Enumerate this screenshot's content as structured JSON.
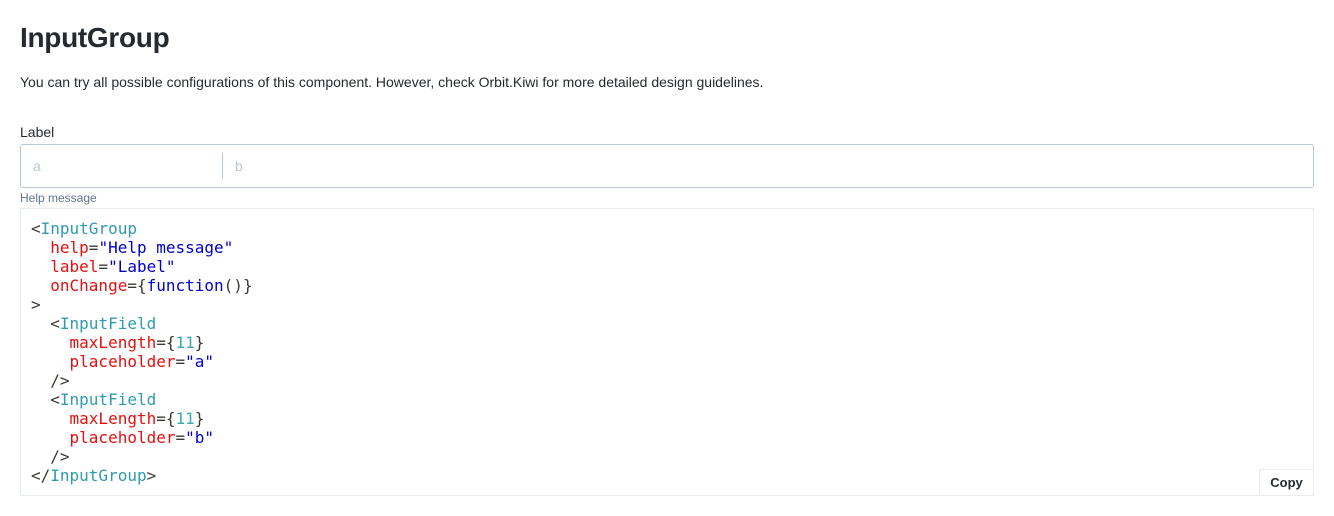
{
  "header": {
    "title": "InputGroup",
    "description": "You can try all possible configurations of this component. However, check Orbit.Kiwi for more detailed design guidelines."
  },
  "input_group": {
    "label": "Label",
    "help": "Help message",
    "fields": [
      {
        "placeholder": "a",
        "value": ""
      },
      {
        "placeholder": "b",
        "value": ""
      }
    ]
  },
  "code": {
    "copy_label": "Copy",
    "tokens": {
      "lt": "<",
      "gt": ">",
      "close_open": "</",
      "self_close": "/>",
      "eq": "=",
      "component_group": "InputGroup",
      "component_field": "InputField",
      "attr_help": "help",
      "attr_label": "label",
      "attr_onchange": "onChange",
      "attr_maxlength": "maxLength",
      "attr_placeholder": "placeholder",
      "val_help": "\"Help message\"",
      "val_label": "\"Label\"",
      "val_function": "function",
      "val_parens": "()",
      "val_maxlength": "11",
      "val_placeholder_a": "\"a\"",
      "val_placeholder_b": "\"b\"",
      "brace_open": "{",
      "brace_close": "}"
    }
  },
  "colors": {
    "border": "#bac7d5",
    "placeholder": "#bac7d5",
    "help_text": "#5f738c",
    "code_tag": "#2f9bb0",
    "code_attr": "#e60f0f",
    "code_string": "#0000cc",
    "code_number": "#36acaa"
  }
}
